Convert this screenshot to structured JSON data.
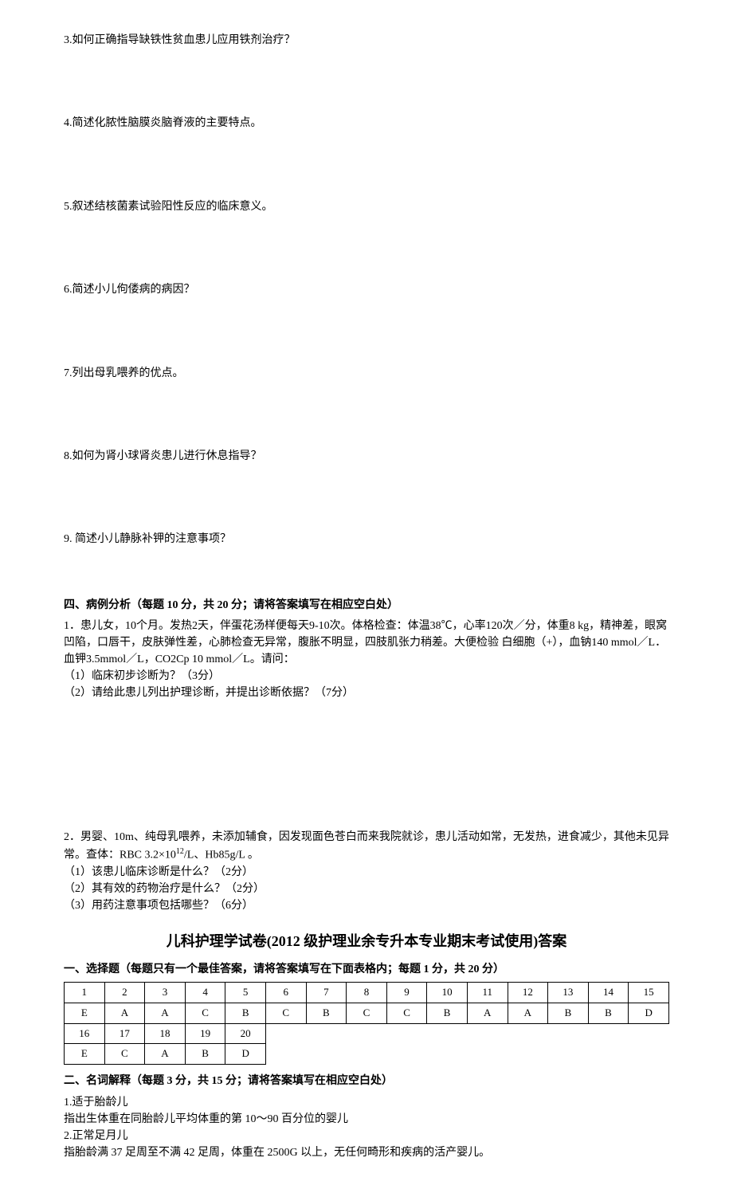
{
  "questions": {
    "q3": "3.如何正确指导缺铁性贫血患儿应用铁剂治疗？",
    "q4": "4.简述化脓性脑膜炎脑脊液的主要特点。",
    "q5": "5.叙述结核菌素试验阳性反应的临床意义。",
    "q6": "6.简述小儿佝偻病的病因？",
    "q7": "7.列出母乳喂养的优点。",
    "q8": "8.如何为肾小球肾炎患儿进行休息指导？",
    "q9": "9. 简述小儿静脉补钾的注意事项？"
  },
  "section4": {
    "header": "四、病例分析（每题 10 分，共 20 分；请将答案填写在相应空白处）",
    "case1": {
      "stem": "1．患儿女，10个月。发热2天，伴蛋花汤样便每天9-10次。体格检查：体温38℃，心率120次／分，体重8 kg，精神差，眼窝凹陷，口唇干，皮肤弹性差，心肺检查无异常，腹胀不明显，四肢肌张力稍差。大便检验 白细胞（+），血钠140 mmol／L．血钾3.5mmol／L，CO2Cp 10 mmol／L。请问：",
      "sub1": "（1）临床初步诊断为？（3分）",
      "sub2": "（2）请给此患儿列出护理诊断，并提出诊断依据？（7分）"
    },
    "case2": {
      "stem_a": "2．男婴、10m、纯母乳喂养，未添加辅食，因发现面色苍白而来我院就诊，患儿活动如常，无发热，进食减少，其他未见异常。查体：RBC 3.2×10",
      "stem_sup": "12",
      "stem_b": "/L、Hb85g/L 。",
      "sub1": "（1）该患儿临床诊断是什么？（2分）",
      "sub2": "（2）其有效的药物治疗是什么？（2分）",
      "sub3": "（3）用药注意事项包括哪些？（6分）"
    }
  },
  "answer": {
    "title": "儿科护理学试卷(2012 级护理业余专升本专业期末考试使用)答案",
    "mc_header": "一、选择题（每题只有一个最佳答案，请将答案填写在下面表格内；每题 1 分，共 20 分）",
    "table": {
      "row1": [
        "1",
        "2",
        "3",
        "4",
        "5",
        "6",
        "7",
        "8",
        "9",
        "10",
        "11",
        "12",
        "13",
        "14",
        "15"
      ],
      "row2": [
        "E",
        "A",
        "A",
        "C",
        "B",
        "C",
        "B",
        "C",
        "C",
        "B",
        "A",
        "A",
        "B",
        "B",
        "D"
      ],
      "row3": [
        "16",
        "17",
        "18",
        "19",
        "20"
      ],
      "row4": [
        "E",
        "C",
        "A",
        "B",
        "D"
      ]
    },
    "terms_header": "二、名词解释（每题 3 分，共 15 分；请将答案填写在相应空白处）",
    "term1_name": "1.适于胎龄儿",
    "term1_def": "指出生体重在同胎龄儿平均体重的第 10～90 百分位的婴儿",
    "term2_name": "2.正常足月儿",
    "term2_def": "指胎龄满 37 足周至不满 42 足周，体重在 2500G 以上，无任何畸形和疾病的活产婴儿。"
  }
}
